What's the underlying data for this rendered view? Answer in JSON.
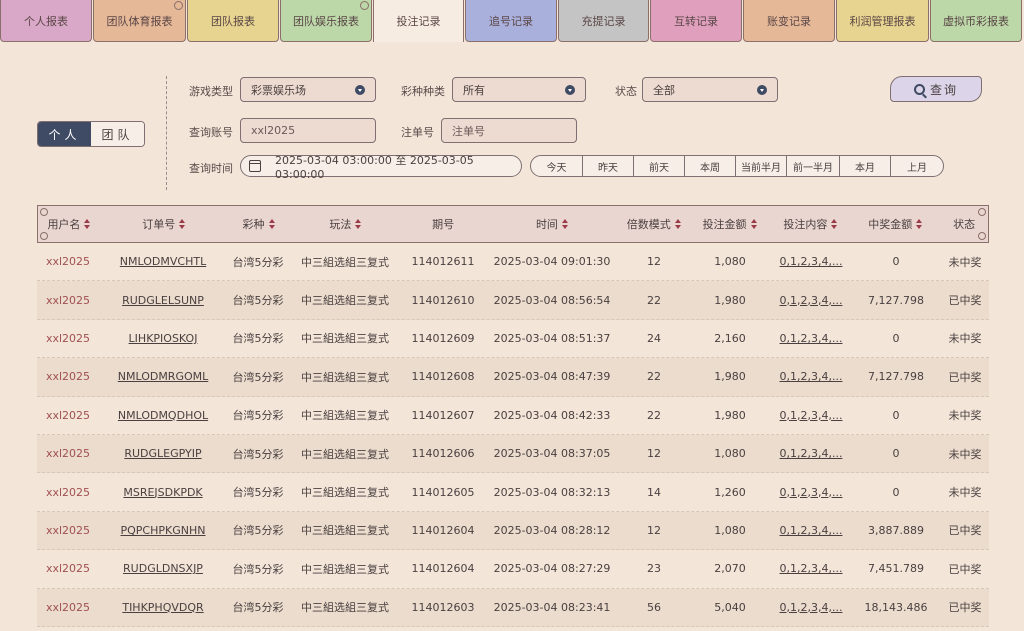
{
  "tabs": [
    {
      "label": "个人报表",
      "color": "#d9a8c8"
    },
    {
      "label": "团队体育报表",
      "color": "#e5b898"
    },
    {
      "label": "团队报表",
      "color": "#e6d490"
    },
    {
      "label": "团队娱乐报表",
      "color": "#bcd7a8"
    },
    {
      "label": "投注记录",
      "color": "#f7ece2",
      "active": true
    },
    {
      "label": "追号记录",
      "color": "#aab0dc"
    },
    {
      "label": "充提记录",
      "color": "#c4c4c4"
    },
    {
      "label": "互转记录",
      "color": "#df9fbd"
    },
    {
      "label": "账变记录",
      "color": "#e5b898"
    },
    {
      "label": "利润管理报表",
      "color": "#e6d490"
    },
    {
      "label": "虚拟币彩报表",
      "color": "#bcd7a8"
    }
  ],
  "toggle": {
    "personal": "个人",
    "team": "团队"
  },
  "filters": {
    "game_type_label": "游戏类型",
    "game_type_value": "彩票娱乐场",
    "lottery_type_label": "彩种种类",
    "lottery_type_value": "所有",
    "status_label": "状态",
    "status_value": "全部",
    "account_label": "查询账号",
    "account_value": "xxl2025",
    "order_label": "注单号",
    "order_placeholder": "注单号",
    "time_label": "查询时间",
    "time_value": "2025-03-04 03:00:00 至 2025-03-05 03:00:00",
    "quick_ranges": [
      "今天",
      "昨天",
      "前天",
      "本周",
      "当前半月",
      "前一半月",
      "本月",
      "上月"
    ],
    "query_button": "查询"
  },
  "table": {
    "headers": [
      "用户名",
      "订单号",
      "彩种",
      "玩法",
      "期号",
      "时间",
      "倍数模式",
      "投注金额",
      "投注内容",
      "中奖金额",
      "状态"
    ],
    "sortable": [
      true,
      true,
      true,
      true,
      false,
      true,
      true,
      true,
      true,
      true,
      false
    ],
    "rows": [
      [
        "xxl2025",
        "NMLODMVCHTL",
        "台湾5分彩",
        "中三組选組三复式",
        "114012611",
        "2025-03-04 09:01:30",
        "12",
        "1,080",
        "0,1,2,3,4,...",
        "0",
        "未中奖"
      ],
      [
        "xxl2025",
        "RUDGLELSUNP",
        "台湾5分彩",
        "中三組选組三复式",
        "114012610",
        "2025-03-04 08:56:54",
        "22",
        "1,980",
        "0,1,2,3,4,...",
        "7,127.798",
        "已中奖"
      ],
      [
        "xxl2025",
        "LIHKPIOSKOJ",
        "台湾5分彩",
        "中三組选組三复式",
        "114012609",
        "2025-03-04 08:51:37",
        "24",
        "2,160",
        "0,1,2,3,4,...",
        "0",
        "未中奖"
      ],
      [
        "xxl2025",
        "NMLODMRGOML",
        "台湾5分彩",
        "中三組选組三复式",
        "114012608",
        "2025-03-04 08:47:39",
        "22",
        "1,980",
        "0,1,2,3,4,...",
        "7,127.798",
        "已中奖"
      ],
      [
        "xxl2025",
        "NMLODMQDHOL",
        "台湾5分彩",
        "中三組选組三复式",
        "114012607",
        "2025-03-04 08:42:33",
        "22",
        "1,980",
        "0,1,2,3,4,...",
        "0",
        "未中奖"
      ],
      [
        "xxl2025",
        "RUDGLEGPYIP",
        "台湾5分彩",
        "中三組选組三复式",
        "114012606",
        "2025-03-04 08:37:05",
        "12",
        "1,080",
        "0,1,2,3,4,...",
        "0",
        "未中奖"
      ],
      [
        "xxl2025",
        "MSREJSDKPDK",
        "台湾5分彩",
        "中三組选組三复式",
        "114012605",
        "2025-03-04 08:32:13",
        "14",
        "1,260",
        "0,1,2,3,4,...",
        "0",
        "未中奖"
      ],
      [
        "xxl2025",
        "PQPCHPKGNHN",
        "台湾5分彩",
        "中三組选組三复式",
        "114012604",
        "2025-03-04 08:28:12",
        "12",
        "1,080",
        "0,1,2,3,4,...",
        "3,887.889",
        "已中奖"
      ],
      [
        "xxl2025",
        "RUDGLDNSXJP",
        "台湾5分彩",
        "中三組选組三复式",
        "114012604",
        "2025-03-04 08:27:29",
        "23",
        "2,070",
        "0,1,2,3,4,...",
        "7,451.789",
        "已中奖"
      ],
      [
        "xxl2025",
        "TIHKPHQVDQR",
        "台湾5分彩",
        "中三組选組三复式",
        "114012603",
        "2025-03-04 08:23:41",
        "56",
        "5,040",
        "0,1,2,3,4,...",
        "18,143.486",
        "已中奖"
      ]
    ]
  }
}
